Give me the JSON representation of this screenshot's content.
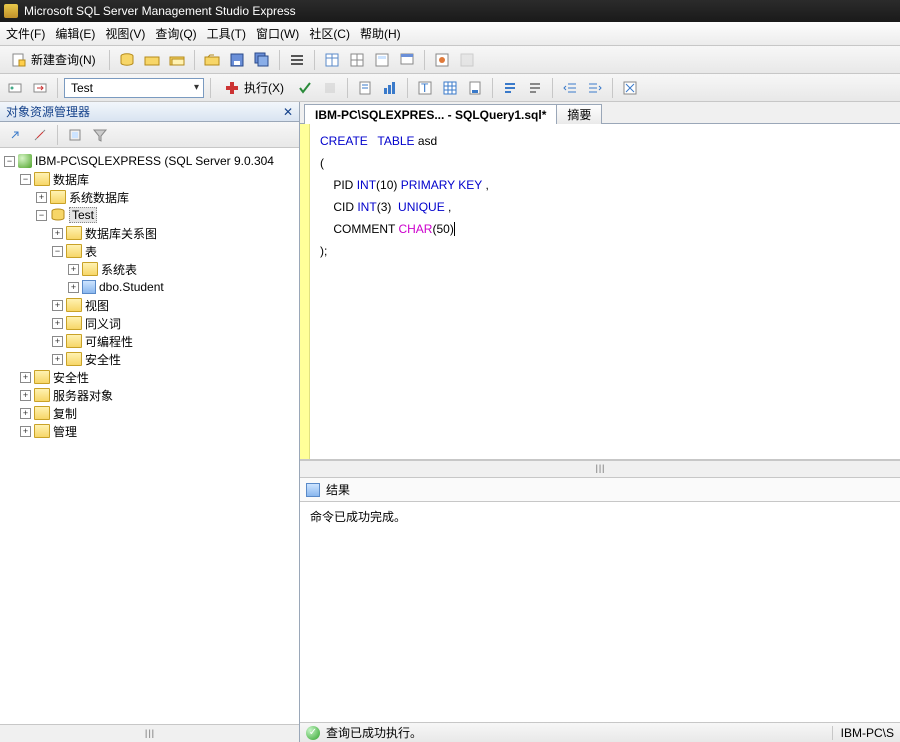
{
  "title": "Microsoft SQL Server Management Studio Express",
  "menus": [
    "文件(F)",
    "编辑(E)",
    "视图(V)",
    "查询(Q)",
    "工具(T)",
    "窗口(W)",
    "社区(C)",
    "帮助(H)"
  ],
  "newQueryLabel": "新建查询(N)",
  "executeLabel": "执行(X)",
  "dbCombo": "Test",
  "sidebar": {
    "title": "对象资源管理器",
    "root": "IBM-PC\\SQLEXPRESS (SQL Server 9.0.304",
    "nodes": {
      "databases": "数据库",
      "sysdb": "系统数据库",
      "testdb": "Test",
      "diagrams": "数据库关系图",
      "tables": "表",
      "systables": "系统表",
      "student": "dbo.Student",
      "views": "视图",
      "synonyms": "同义词",
      "programmability": "可编程性",
      "security_db": "安全性",
      "security": "安全性",
      "serverobj": "服务器对象",
      "replication": "复制",
      "management": "管理"
    }
  },
  "tabs": {
    "active": "IBM-PC\\SQLEXPRES... - SQLQuery1.sql*",
    "summary": "摘要"
  },
  "sql": {
    "l1a": "CREATE",
    "l1b": "TABLE",
    "l1c": " asd",
    "l2": "(",
    "l3a": "    PID ",
    "l3b": "INT",
    "l3c": "(",
    "l3d": "10",
    "l3e": ")",
    "l3f": " PRIMARY",
    "l3g": " KEY",
    "l3h": " ,",
    "l4a": "    CID ",
    "l4b": "INT",
    "l4c": "(",
    "l4d": "3",
    "l4e": ")",
    "l4f": "  UNIQUE",
    "l4g": " ,",
    "l5a": "    COMMENT ",
    "l5b": "CHAR",
    "l5c": "(",
    "l5d": "50",
    "l5e": ")",
    "l6": ");"
  },
  "results": {
    "tab": "结果",
    "message": "命令已成功完成。"
  },
  "status": {
    "text": "查询已成功执行。",
    "server": "IBM-PC\\S"
  },
  "hscroll": "III"
}
